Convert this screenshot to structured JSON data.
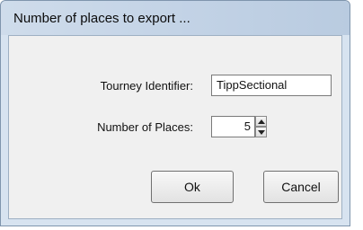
{
  "window": {
    "title": "Number of places to export ..."
  },
  "form": {
    "tourney_identifier_label": "Tourney Identifier:",
    "tourney_identifier_value": "TippSectional",
    "number_of_places_label": "Number of Places:",
    "number_of_places_value": "5"
  },
  "buttons": {
    "ok_label": "Ok",
    "cancel_label": "Cancel"
  },
  "icons": {
    "spin_up": "arrow-up-icon",
    "spin_down": "arrow-down-icon"
  }
}
